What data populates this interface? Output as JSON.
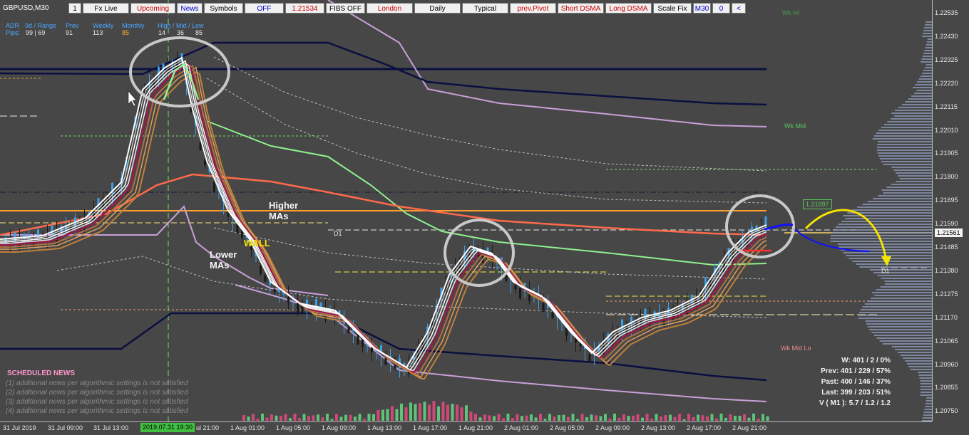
{
  "chart": {
    "symbol": "GBPUSD,M30",
    "colors": {
      "background": "#474747",
      "axis": "#bbbbbb",
      "text": "#e8e8e8",
      "up": "#3ea0e6",
      "down": "#1a1a1a"
    }
  },
  "toolbar": {
    "items": [
      {
        "label": "1",
        "fg": "#000000",
        "w": 18
      },
      {
        "label": "Fx Live",
        "fg": "#000000",
        "w": 65
      },
      {
        "label": "Upcoming",
        "fg": "#cc0000",
        "w": 63
      },
      {
        "label": "News",
        "fg": "#0000cc",
        "w": 36
      },
      {
        "label": "Symbols",
        "fg": "#000000",
        "w": 55
      },
      {
        "label": "OFF",
        "fg": "#0000cc",
        "w": 55
      },
      {
        "label": "1.21534",
        "fg": "#cc0000",
        "w": 55
      },
      {
        "label": "FIBS OFF",
        "fg": "#000000",
        "w": 55
      },
      {
        "label": "London",
        "fg": "#cc0000",
        "w": 65
      },
      {
        "label": "Daily",
        "fg": "#000000",
        "w": 65
      },
      {
        "label": "Typical",
        "fg": "#000000",
        "w": 65
      },
      {
        "label": "prev.Pivot",
        "fg": "#cc0000",
        "w": 65
      },
      {
        "label": "Short DSMA",
        "fg": "#cc0000",
        "w": 65
      },
      {
        "label": "Long DSMA",
        "fg": "#cc0000",
        "w": 65
      },
      {
        "label": "Scale Fix",
        "fg": "#000000",
        "w": 54
      },
      {
        "label": "M30",
        "fg": "#0000cc",
        "w": 25
      },
      {
        "label": "0",
        "fg": "#0000cc",
        "w": 25
      },
      {
        "label": "<",
        "fg": "#0000cc",
        "w": 20
      }
    ]
  },
  "stats_header": {
    "adr": "ADR",
    "nine_day_range": "9d / Range",
    "prev": "Prev",
    "weekly": "Weekly",
    "monthly": "Monthly",
    "hml": "High / Mid / Low",
    "pips": "Pips:",
    "v_nine": "99 | 69",
    "v_prev": "91",
    "v_weekly": "113",
    "v_monthly": "85",
    "v_h": "14",
    "v_m": "36",
    "v_l": "85"
  },
  "price_axis": {
    "ticks": [
      "1.22535",
      "1.22430",
      "1.22325",
      "1.22220",
      "1.22115",
      "1.22010",
      "1.21905",
      "1.21800",
      "1.21695",
      "1.21590",
      "1.21485",
      "1.21380",
      "1.21275",
      "1.21170",
      "1.21065",
      "1.20960",
      "1.20855",
      "1.20750"
    ],
    "current_price": "1.21561",
    "marker_price": "1.21697"
  },
  "time_axis": {
    "ticks": [
      "31 Jul 2019",
      "31 Jul 09:00",
      "31 Jul 13:00",
      "2019.07.31 19:30",
      "ul 21:00",
      "1 Aug 01:00",
      "1 Aug 05:00",
      "1 Aug 09:00",
      "1 Aug 13:00",
      "1 Aug 17:00",
      "1 Aug 21:00",
      "2 Aug 01:00",
      "2 Aug 05:00",
      "2 Aug 09:00",
      "2 Aug 13:00",
      "2 Aug 17:00",
      "2 Aug 21:00"
    ]
  },
  "levels": {
    "wk_hi": "Wk Hi",
    "wk_mid": "Wk Mid",
    "wk_mid_lo": "Wk Mid Lo",
    "d1": "D1"
  },
  "annotations": {
    "higher_mas": "Higher\nMAs",
    "lower_mas": "Lower\nMAs",
    "wall": "WALL"
  },
  "news": {
    "title": "SCHEDULED NEWS",
    "lines": [
      "(1) additional news per algorithmic settings is not satisfied",
      "(2) additional news per algorithmic settings is not satisfied",
      "(3) additional news per algorithmic settings is not satisfied",
      "(4) additional news per algorithmic settings is not satisfied"
    ]
  },
  "stats_box": {
    "lines": [
      "W: 401 / 2 / 0%",
      "Prev: 401 / 229 / 57%",
      "Past: 400 / 146 / 37%",
      "Last: 399 / 203 / 51%",
      "V ( M1 ): 5.7 / 1.2 / 1.2"
    ]
  }
}
